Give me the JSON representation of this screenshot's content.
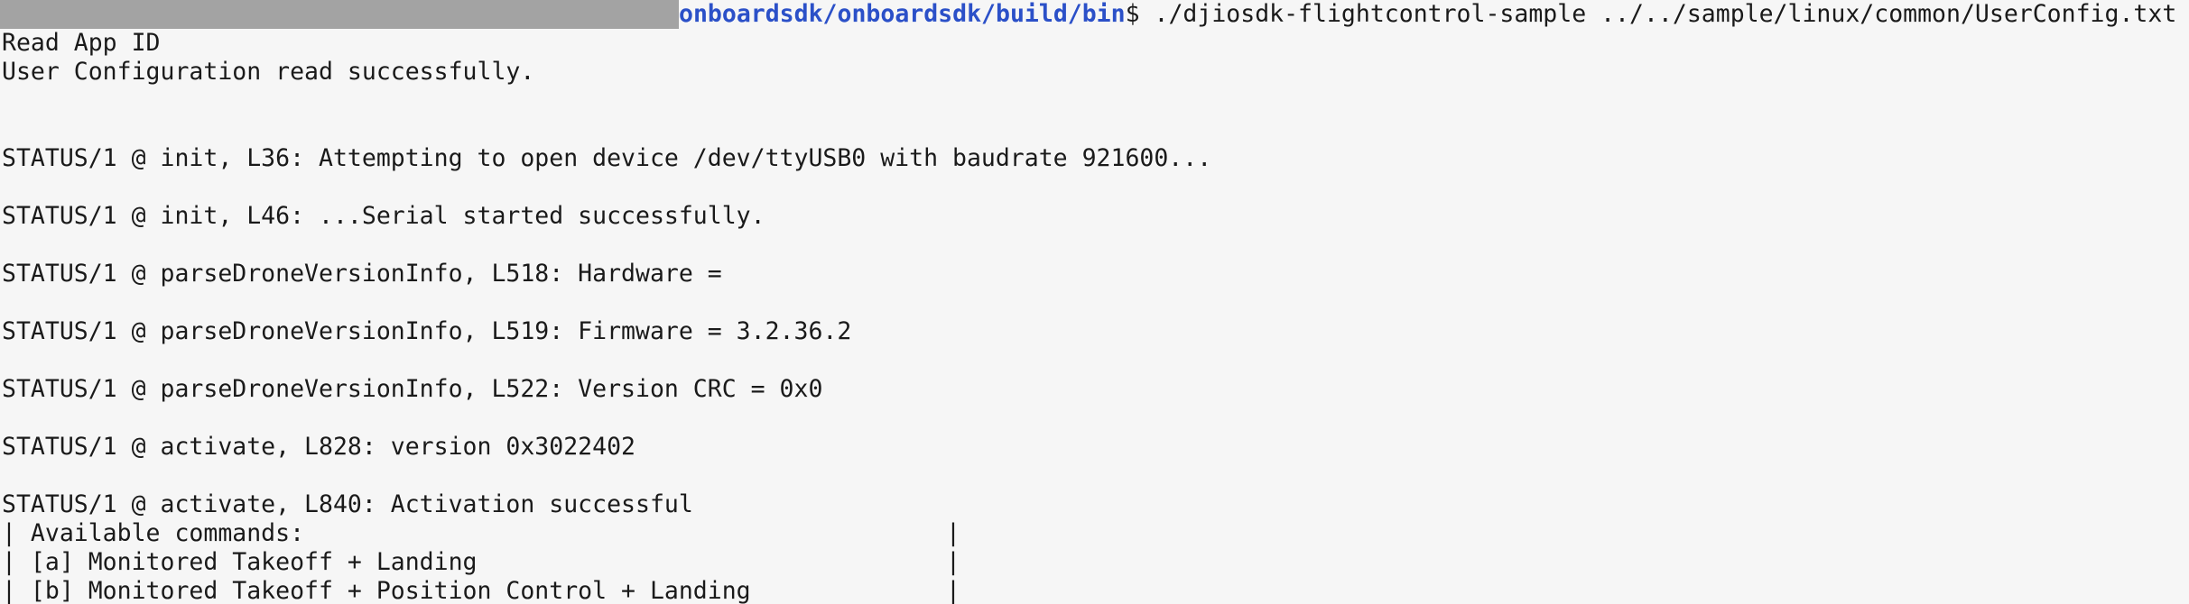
{
  "prompt": {
    "path": "onboardsdk/onboardsdk/build/bin",
    "symbol": "$",
    "command": " ./djiosdk-flightcontrol-sample ../../sample/linux/common/UserConfig.txt"
  },
  "lines": [
    "Read App ID",
    "User Configuration read successfully.",
    "STATUS/1 @ init, L36: Attempting to open device /dev/ttyUSB0 with baudrate 921600...",
    "STATUS/1 @ init, L46: ...Serial started successfully.",
    "STATUS/1 @ parseDroneVersionInfo, L518: Hardware =",
    "STATUS/1 @ parseDroneVersionInfo, L519: Firmware = 3.2.36.2",
    "STATUS/1 @ parseDroneVersionInfo, L522: Version CRC = 0x0",
    "STATUS/1 @ activate, L828: version 0x3022402",
    "STATUS/1 @ activate, L840: Activation successful"
  ],
  "menu": {
    "border": "|",
    "rows": [
      "| Available commands:",
      "| [a] Monitored Takeoff + Landing",
      "| [b] Monitored Takeoff + Position Control + Landing"
    ]
  }
}
